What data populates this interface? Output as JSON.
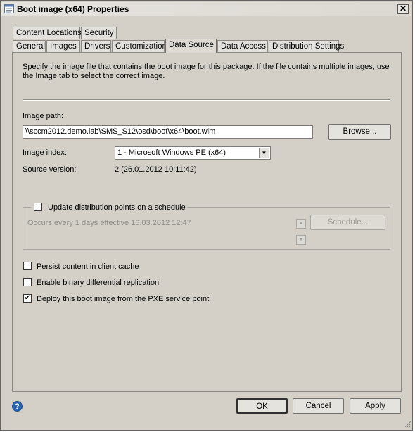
{
  "window": {
    "title": "Boot image (x64) Properties",
    "close_glyph": "✕"
  },
  "tabs": {
    "row1": [
      {
        "label": "Content Locations"
      },
      {
        "label": "Security"
      }
    ],
    "row2": [
      {
        "label": "General"
      },
      {
        "label": "Images"
      },
      {
        "label": "Drivers"
      },
      {
        "label": "Customization"
      },
      {
        "label": "Data Source",
        "active": true
      },
      {
        "label": "Data Access"
      },
      {
        "label": "Distribution Settings"
      }
    ]
  },
  "data_source": {
    "description": "Specify the image file that contains the boot image for this package. If the file contains multiple images, use the Image tab to select the correct image.",
    "image_path_label": "Image path:",
    "image_path_value": "\\\\sccm2012.demo.lab\\SMS_S12\\osd\\boot\\x64\\boot.wim",
    "browse_label": "Browse...",
    "image_index_label": "Image index:",
    "image_index_value": "1 - Microsoft Windows PE (x64)",
    "source_version_label": "Source version:",
    "source_version_value": "2 (26.01.2012 10:11:42)"
  },
  "schedule": {
    "checkbox_label": "Update distribution points on a schedule",
    "checked": false,
    "summary": "Occurs every 1 days effective 16.03.2012 12:47",
    "schedule_button": "Schedule..."
  },
  "options": [
    {
      "label": "Persist content in client cache",
      "checked": false,
      "mark": ""
    },
    {
      "label": "Enable binary differential replication",
      "checked": false,
      "mark": ""
    },
    {
      "label": "Deploy this boot image from the PXE service point",
      "checked": true,
      "mark": "✔"
    }
  ],
  "footer": {
    "help_glyph": "?",
    "ok_label": "OK",
    "cancel_label": "Cancel",
    "apply_label": "Apply"
  }
}
